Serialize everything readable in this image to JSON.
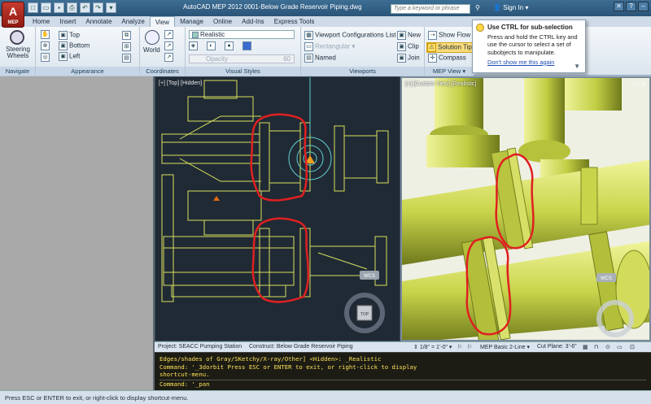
{
  "titlebar": {
    "app_logo": "A",
    "app_sub": "MEP",
    "title": "AutoCAD MEP 2012     0001-Below Grade Reservoir Piping.dwg",
    "search_placeholder": "Type a keyword or phrase",
    "signin": "Sign In",
    "qat_icons": [
      "new-icon",
      "open-icon",
      "save-icon",
      "print-icon",
      "undo-icon",
      "redo-icon",
      "plot-icon"
    ]
  },
  "tabs": [
    "Home",
    "Insert",
    "Annotate",
    "Analyze",
    "View",
    "Manage",
    "Online",
    "Add-Ins",
    "Express Tools"
  ],
  "active_tab": "View",
  "ribbon": {
    "navigate": {
      "steering_wheels": "Steering Wheels",
      "title": "Navigate"
    },
    "appearance": {
      "top": "Top",
      "bottom": "Bottom",
      "left": "Left",
      "title": "Appearance"
    },
    "coordinates": {
      "world": "World",
      "title": "Coordinates"
    },
    "visual_styles": {
      "style": "Realistic",
      "opacity_label": "Opacity",
      "opacity_value": "60",
      "title": "Visual Styles"
    },
    "viewports": {
      "config_list": "Viewport Configurations List",
      "rectangular": "Rectangular",
      "named": "Named",
      "new": "New",
      "clip": "Clip",
      "join": "Join",
      "title": "Viewports"
    },
    "mep_view": {
      "show_flow": "Show Flow",
      "solution_tips": "Solution Tips",
      "compass": "Compass",
      "title": "MEP View"
    }
  },
  "tooltip": {
    "title": "Use CTRL for sub-selection",
    "body": "Press and hold the CTRL key and use the cursor to select a set of subobjects to manipulate.",
    "link": "Don't show me this again"
  },
  "viewports": {
    "left_label": "[+] [Top] [Hidden]",
    "right_label": "[+] [Custom View] [Realistic]",
    "wcs": "WCS",
    "viewcube_face": "TOP"
  },
  "status": {
    "project": "Project: SEACC Pumping Station",
    "construct": "Construct: Below Grade Reservoir Piping",
    "scale": "1/8\" = 1'-0\"",
    "display": "MEP Basic 2-Line",
    "cut_plane": "Cut Plane:  3'-6\""
  },
  "command": {
    "lines": [
      "Edges/shades of Gray/SKetchy/X-ray/Other] <Hidden>: _Realistic",
      "Command: '_3dorbit Press ESC or ENTER to exit, or right-click to display",
      "shortcut-menu."
    ],
    "input": "Command: '_pan"
  },
  "bottom_status": "Press ESC or ENTER to exit, or right-click to display shortcut-menu.",
  "colors": {
    "pipe_3d": "#c8d44a",
    "cad_lines": "#d8e05a",
    "viewport_bg": "#202a35",
    "markup": "#e02020"
  }
}
